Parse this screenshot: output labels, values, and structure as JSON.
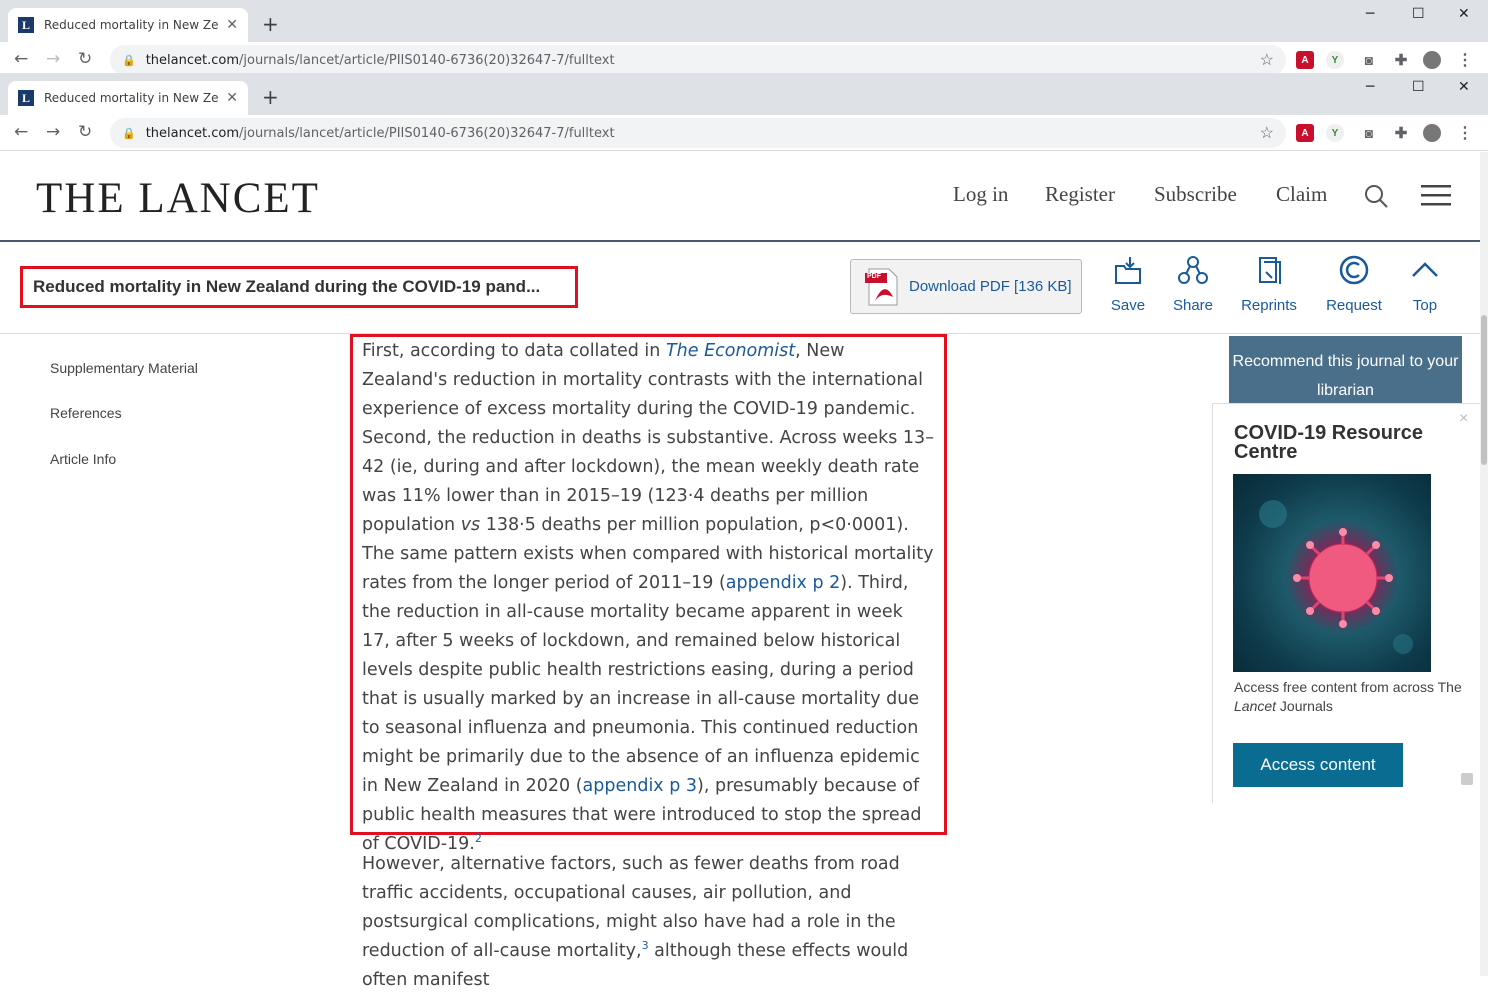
{
  "browser": {
    "tab_title": "Reduced mortality in New Zealan",
    "url_host": "thelancet.com",
    "url_path": "/journals/lancet/article/PIIS0140-6736(20)32647-7/fulltext"
  },
  "header": {
    "logo": "THE LANCET",
    "nav": [
      "Log in",
      "Register",
      "Subscribe",
      "Claim"
    ]
  },
  "article_bar": {
    "title": "Reduced mortality in New Zealand during the COVID-19 pand...",
    "download_label": "Download PDF [136 KB]",
    "pdf_icon_text": "PDF",
    "actions": [
      "Save",
      "Share",
      "Reprints",
      "Request",
      "Top"
    ]
  },
  "sidenav": [
    "Supplementary Material",
    "References",
    "Article Info"
  ],
  "paragraph1": {
    "t1": "First, according to data collated in ",
    "economist": "The Economist",
    "t2": ", New Zealand's reduction in mortality contrasts with the international experience of excess mortality during the COVID-19 pandemic. Second, the reduction in deaths is substantive. Across weeks 13–42 (ie, during and after lockdown), the mean weekly death rate was 11% lower than in 2015–19 (123·4 deaths per million population ",
    "vs": "vs",
    "t3": " 138·5 deaths per million population, p<0·0001). The same pattern exists when compared with historical mortality rates from the longer period of 2011–19 (",
    "appendix1": "appendix p 2",
    "t4": "). Third, the reduction in all-cause mortality became apparent in week 17, after 5 weeks of lockdown, and remained below historical levels despite public health restrictions easing, during a period that is usually marked by an increase in all-cause mortality due to seasonal influenza and pneumonia. This continued reduction might be primarily due to the absence of an influenza epidemic in New Zealand in 2020 (",
    "appendix2": "appendix p 3",
    "t5": "), presumably because of public health measures that were introduced to stop the spread of COVID-19.",
    "ref": "2"
  },
  "paragraph2": {
    "t1": "However, alternative factors, such as fewer deaths from road traffic accidents, occupational causes, air pollution, and postsurgical complications, might also have had a role in the reduction of all-cause mortality,",
    "ref": "3",
    "t2": " although these effects would often manifest"
  },
  "sidebar": {
    "recommend": "Recommend this journal to your librarian",
    "ad_title": "COVID-19 Resource Centre",
    "ad_desc_1": "Access free content from across The ",
    "ad_desc_italic": "Lancet",
    "ad_desc_2": " Journals",
    "ad_button": "Access content",
    "ad_close": "×"
  }
}
